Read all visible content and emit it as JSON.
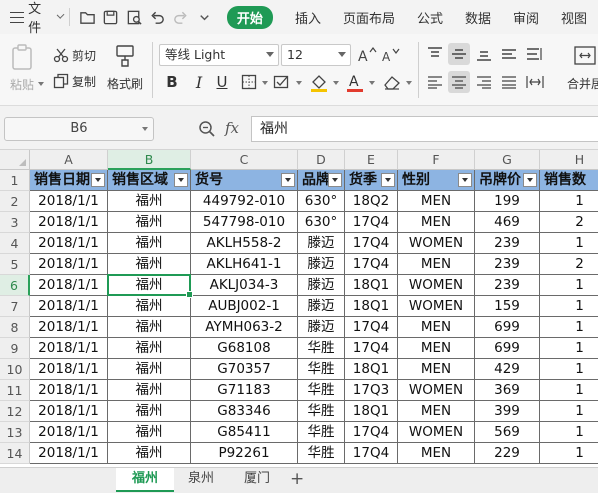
{
  "menubar": {
    "file_label": "文件",
    "tabs": [
      {
        "label": "开始",
        "active": true
      },
      {
        "label": "插入",
        "active": false
      },
      {
        "label": "页面布局",
        "active": false
      },
      {
        "label": "公式",
        "active": false
      },
      {
        "label": "数据",
        "active": false
      },
      {
        "label": "审阅",
        "active": false
      },
      {
        "label": "视图",
        "active": false
      }
    ],
    "accent_color": "#1f9a55"
  },
  "ribbon": {
    "paste_label": "粘贴",
    "cut_label": "剪切",
    "copy_label": "复制",
    "format_painter_label": "格式刷",
    "font_name": "等线 Light",
    "font_size": "12",
    "merge_label": "合并居"
  },
  "formula_bar": {
    "name_box": "B6",
    "fx_label": "fx",
    "formula_value": "福州"
  },
  "sheet": {
    "columns": [
      "A",
      "B",
      "C",
      "D",
      "E",
      "F",
      "G",
      "H"
    ],
    "selected_column": "B",
    "selected_row": "6",
    "header_fill": "#8db4e2",
    "header_row": [
      "销售日期",
      "销售区域",
      "货号",
      "品牌",
      "货季",
      "性别",
      "吊牌价",
      "销售数"
    ],
    "row_numbers": [
      "1",
      "2",
      "3",
      "4",
      "5",
      "6",
      "7",
      "8",
      "9",
      "10",
      "11",
      "12",
      "13",
      "14"
    ],
    "rows": [
      [
        "2018/1/1",
        "福州",
        "449792-010",
        "630°",
        "18Q2",
        "MEN",
        "199",
        "1"
      ],
      [
        "2018/1/1",
        "福州",
        "547798-010",
        "630°",
        "17Q4",
        "MEN",
        "469",
        "2"
      ],
      [
        "2018/1/1",
        "福州",
        "AKLH558-2",
        "滕迈",
        "17Q4",
        "WOMEN",
        "239",
        "1"
      ],
      [
        "2018/1/1",
        "福州",
        "AKLH641-1",
        "滕迈",
        "17Q4",
        "MEN",
        "239",
        "2"
      ],
      [
        "2018/1/1",
        "福州",
        "AKLJ034-3",
        "滕迈",
        "18Q1",
        "WOMEN",
        "239",
        "1"
      ],
      [
        "2018/1/1",
        "福州",
        "AUBJ002-1",
        "滕迈",
        "18Q1",
        "WOMEN",
        "159",
        "1"
      ],
      [
        "2018/1/1",
        "福州",
        "AYMH063-2",
        "滕迈",
        "17Q4",
        "MEN",
        "699",
        "1"
      ],
      [
        "2018/1/1",
        "福州",
        "G68108",
        "华胜",
        "17Q4",
        "MEN",
        "699",
        "1"
      ],
      [
        "2018/1/1",
        "福州",
        "G70357",
        "华胜",
        "18Q1",
        "MEN",
        "429",
        "1"
      ],
      [
        "2018/1/1",
        "福州",
        "G71183",
        "华胜",
        "17Q3",
        "WOMEN",
        "369",
        "1"
      ],
      [
        "2018/1/1",
        "福州",
        "G83346",
        "华胜",
        "18Q1",
        "MEN",
        "399",
        "1"
      ],
      [
        "2018/1/1",
        "福州",
        "G85411",
        "华胜",
        "17Q4",
        "WOMEN",
        "569",
        "1"
      ],
      [
        "2018/1/1",
        "福州",
        "P92261",
        "华胜",
        "17Q4",
        "MEN",
        "229",
        "1"
      ]
    ]
  },
  "sheet_tabs": [
    {
      "label": "福州",
      "active": true
    },
    {
      "label": "泉州",
      "active": false
    },
    {
      "label": "厦门",
      "active": false
    }
  ],
  "add_sheet_label": "+"
}
